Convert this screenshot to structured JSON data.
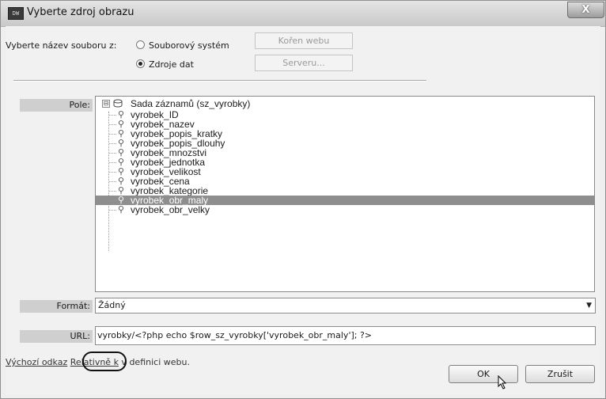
{
  "window": {
    "app_icon": "DW",
    "title": "Vyberte zdroj obrazu",
    "close_glyph": "X"
  },
  "source": {
    "label": "Vyberte název souboru z:",
    "options": [
      {
        "label": "Souborový systém",
        "selected": false
      },
      {
        "label": "Zdroje dat",
        "selected": true
      }
    ],
    "buttons": [
      "Kořen webu",
      "Serveru..."
    ]
  },
  "fields": {
    "label": "Pole:",
    "root_toggle": "⊟",
    "root_label": "Sada záznamů (sz_vyrobky)",
    "items": [
      "vyrobek_ID",
      "vyrobek_nazev",
      "vyrobek_popis_kratky",
      "vyrobek_popis_dlouhy",
      "vyrobek_mnozstvi",
      "vyrobek_jednotka",
      "vyrobek_velikost",
      "vyrobek_cena",
      "vyrobek_kategorie",
      "vyrobek_obr_maly",
      "vyrobek_obr_velky"
    ],
    "selected_item": "vyrobek_obr_maly"
  },
  "format": {
    "label": "Formát:",
    "value": "Žádný"
  },
  "url": {
    "label": "URL:",
    "value": "vyrobky/<?php echo $row_sz_vyrobky['vyrobek_obr_maly']; ?>"
  },
  "footer": {
    "link_prefix": "Výchozí odkaz",
    "link_value": "Relativně k",
    "suffix": " v definici webu."
  },
  "buttons": {
    "ok": "OK",
    "cancel": "Zrušit"
  },
  "colors": {
    "selection": "#8e8e8e",
    "label_bg": "#cfcfcf",
    "dialog_bg": "#f1f1f1"
  },
  "icons": {
    "field": "pin-icon",
    "recordset": "recordset-icon",
    "cursor": "mouse-pointer-icon"
  }
}
